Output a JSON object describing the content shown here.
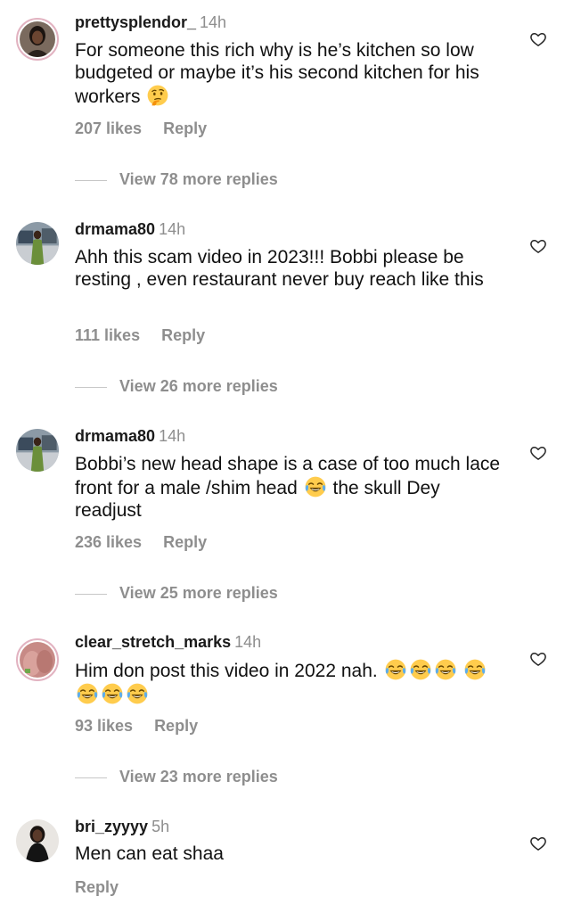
{
  "comments": [
    {
      "username": "prettysplendor_",
      "time": "14h",
      "text_parts": [
        "For someone this rich why is he’s kitchen so low budgeted or maybe it’s his second kitchen for his workers"
      ],
      "emoji": "thinking-face",
      "likes": "207 likes",
      "reply": "Reply",
      "more_replies": "View 78 more replies"
    },
    {
      "username": "drmama80",
      "time": "14h",
      "text": "Ahh this scam video in 2023!!! Bobbi please be resting , even restaurant never buy reach like this",
      "likes": "111 likes",
      "reply": "Reply",
      "more_replies": "View 26 more replies"
    },
    {
      "username": "drmama80",
      "time": "14h",
      "text_before": "Bobbi’s new head shape is a case of too much lace front for a male /shim head",
      "text_after": "the skull Dey readjust",
      "emoji": "face-with-tears-of-joy",
      "likes": "236 likes",
      "reply": "Reply",
      "more_replies": "View 25 more replies"
    },
    {
      "username": "clear_stretch_marks",
      "time": "14h",
      "text": "Him don post this video in 2022 nah.",
      "emoji": "face-with-tears-of-joy",
      "emoji_count": 7,
      "likes": "93 likes",
      "reply": "Reply",
      "more_replies": "View 23 more replies"
    },
    {
      "username": "bri_zyyyy",
      "time": "5h",
      "text": "Men can eat shaa",
      "reply": "Reply"
    }
  ],
  "colors": {
    "text": "#111111",
    "muted": "#8e8e8e",
    "divider": "#c7c7c7"
  },
  "icons": {
    "like": "heart-outline-icon"
  }
}
